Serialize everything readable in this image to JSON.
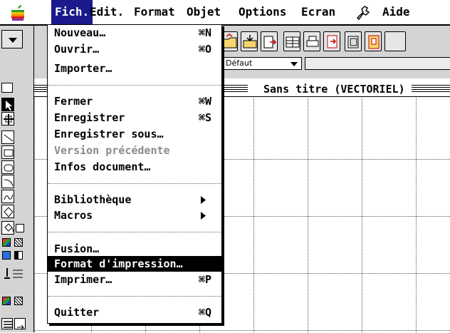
{
  "menubar": {
    "items": [
      {
        "label": "Fich."
      },
      {
        "label": "Edit."
      },
      {
        "label": "Format"
      },
      {
        "label": "Objet"
      },
      {
        "label": "Options"
      },
      {
        "label": "Ecran"
      },
      {
        "label": "Aide"
      }
    ],
    "active_index": 0,
    "apple_icon": "apple-icon",
    "extra_icon": "tools-icon"
  },
  "file_menu": {
    "items": [
      {
        "label": "Nouveau…",
        "shortcut": "⌘N"
      },
      {
        "label": "Ouvrir…",
        "shortcut": "⌘O"
      },
      {
        "label": "Importer…",
        "shortcut": ""
      },
      {
        "label": "Fermer",
        "shortcut": "⌘W"
      },
      {
        "label": "Enregistrer",
        "shortcut": "⌘S"
      },
      {
        "label": "Enregistrer sous…",
        "shortcut": ""
      },
      {
        "label": "Version précédente",
        "shortcut": "",
        "disabled": true
      },
      {
        "label": "Infos document…",
        "shortcut": ""
      },
      {
        "label": "Bibliothèque",
        "shortcut": "",
        "submenu": true
      },
      {
        "label": "Macros",
        "shortcut": "",
        "submenu": true
      },
      {
        "label": "Fusion…",
        "shortcut": ""
      },
      {
        "label": "Format d'impression…",
        "shortcut": "",
        "highlighted": true
      },
      {
        "label": "Imprimer…",
        "shortcut": "⌘P"
      },
      {
        "label": "Quitter",
        "shortcut": "⌘Q"
      }
    ]
  },
  "toolbar": {
    "style_select": {
      "value": "Défaut"
    },
    "icons": [
      "open-folder-icon",
      "import-icon",
      "columns-icon",
      "print-icon",
      "export-icon",
      "library-icon",
      "document-icon"
    ]
  },
  "document": {
    "title": "Sans titre (VECTORIEL)"
  },
  "colors": {
    "menu_highlight": "#000000",
    "active_menu_title": "#1a1a8c",
    "disabled_text": "#8a8a8a",
    "toolbar_bg": "#d4d4d4"
  }
}
